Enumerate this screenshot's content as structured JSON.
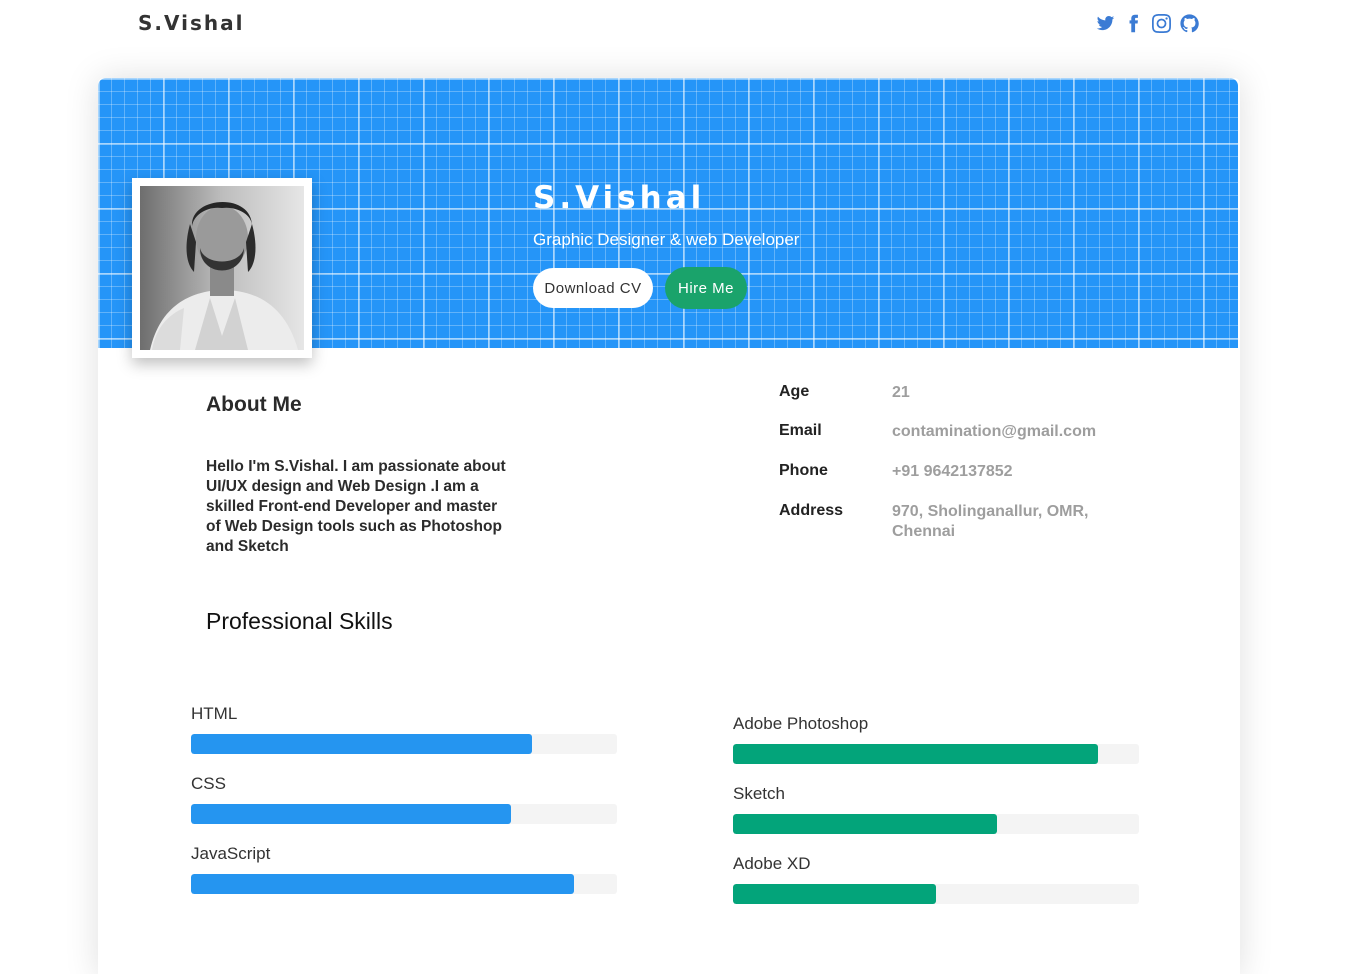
{
  "header": {
    "brand": "S.Vishal",
    "social_icons": [
      "twitter-icon",
      "facebook-icon",
      "instagram-icon",
      "github-icon"
    ],
    "icon_color": "#3b7bd4"
  },
  "hero": {
    "name": "S.Vishal",
    "role": "Graphic Designer & web Developer",
    "download_cv_label": "Download CV",
    "hire_me_label": "Hire Me",
    "banner_color": "#2595f8",
    "hire_color": "#1aa36b"
  },
  "about": {
    "title": "About Me",
    "text": "Hello I'm S.Vishal. I am passionate about UI/UX design and Web Design .I am a skilled Front-end Developer and master of Web Design tools such as Photoshop and Sketch"
  },
  "info": [
    {
      "label": "Age",
      "value": "21"
    },
    {
      "label": "Email",
      "value": "contamination@gmail.com"
    },
    {
      "label": "Phone",
      "value": "+91 9642137852"
    },
    {
      "label": "Address",
      "value": "970, Sholinganallur, OMR, Chennai"
    }
  ],
  "skills": {
    "title": "Professional Skills",
    "left": [
      {
        "name": "HTML",
        "level": 0.8
      },
      {
        "name": "CSS",
        "level": 0.75
      },
      {
        "name": "JavaScript",
        "level": 0.9
      }
    ],
    "right": [
      {
        "name": "Adobe Photoshop",
        "level": 0.9
      },
      {
        "name": "Sketch",
        "level": 0.65
      },
      {
        "name": "Adobe XD",
        "level": 0.5
      }
    ],
    "left_color": "#2595f0",
    "right_color": "#03a47a"
  }
}
